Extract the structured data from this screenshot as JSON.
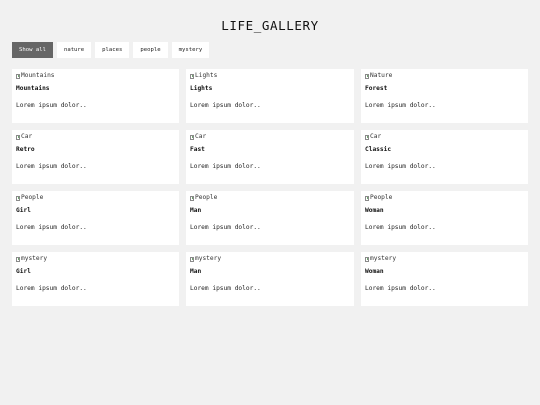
{
  "header": {
    "title": "LIFE_GALLERY"
  },
  "filters": [
    {
      "label": "Show all",
      "active": true
    },
    {
      "label": "nature",
      "active": false
    },
    {
      "label": "places",
      "active": false
    },
    {
      "label": "people",
      "active": false
    },
    {
      "label": "mystery",
      "active": false
    }
  ],
  "cards": [
    {
      "alt": "Mountains",
      "title": "Mountains",
      "text": "Lorem ipsum dolor.."
    },
    {
      "alt": "Lights",
      "title": "Lights",
      "text": "Lorem ipsum dolor.."
    },
    {
      "alt": "Nature",
      "title": "Forest",
      "text": "Lorem ipsum dolor.."
    },
    {
      "alt": "Car",
      "title": "Retro",
      "text": "Lorem ipsum dolor.."
    },
    {
      "alt": "Car",
      "title": "Fast",
      "text": "Lorem ipsum dolor.."
    },
    {
      "alt": "Car",
      "title": "Classic",
      "text": "Lorem ipsum dolor.."
    },
    {
      "alt": "People",
      "title": "Girl",
      "text": "Lorem ipsum dolor.."
    },
    {
      "alt": "People",
      "title": "Man",
      "text": "Lorem ipsum dolor.."
    },
    {
      "alt": "People",
      "title": "Woman",
      "text": "Lorem ipsum dolor.."
    },
    {
      "alt": "mystery",
      "title": "Girl",
      "text": "Lorem ipsum dolor.."
    },
    {
      "alt": "mystery",
      "title": "Man",
      "text": "Lorem ipsum dolor.."
    },
    {
      "alt": "mystery",
      "title": "Woman",
      "text": "Lorem ipsum dolor.."
    }
  ]
}
